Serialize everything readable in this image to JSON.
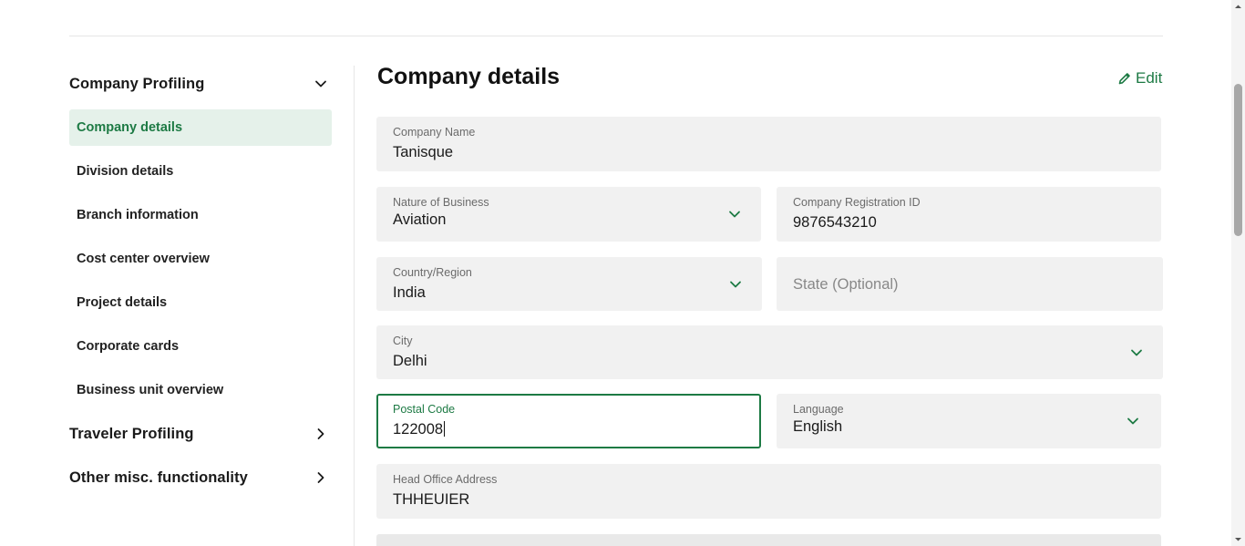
{
  "sidebar": {
    "sections": [
      {
        "title": "Company Profiling",
        "expanded": true
      },
      {
        "title": "Traveler Profiling",
        "expanded": false
      },
      {
        "title": "Other misc. functionality",
        "expanded": false
      }
    ],
    "items": [
      {
        "label": "Company details",
        "active": true
      },
      {
        "label": "Division details"
      },
      {
        "label": "Branch information"
      },
      {
        "label": "Cost center overview"
      },
      {
        "label": "Project details"
      },
      {
        "label": "Corporate cards"
      },
      {
        "label": "Business unit overview"
      }
    ]
  },
  "main": {
    "title": "Company details",
    "edit_label": "Edit",
    "fields": {
      "company_name": {
        "label": "Company Name",
        "value": "Tanisque"
      },
      "nature_of_business": {
        "label": "Nature of Business",
        "value": "Aviation"
      },
      "registration_id": {
        "label": "Company Registration ID",
        "value": "9876543210"
      },
      "country": {
        "label": "Country/Region",
        "value": "India"
      },
      "state": {
        "placeholder": "State (Optional)"
      },
      "city": {
        "label": "City",
        "value": "Delhi"
      },
      "postal_code": {
        "label": "Postal Code",
        "value": "122008"
      },
      "language": {
        "label": "Language",
        "value": "English"
      },
      "head_office": {
        "label": "Head Office Address",
        "value": "THHEUIER"
      }
    }
  },
  "colors": {
    "accent": "#1d7a44",
    "active_bg": "#e5f1ea",
    "field_bg": "#f1f1f1"
  }
}
